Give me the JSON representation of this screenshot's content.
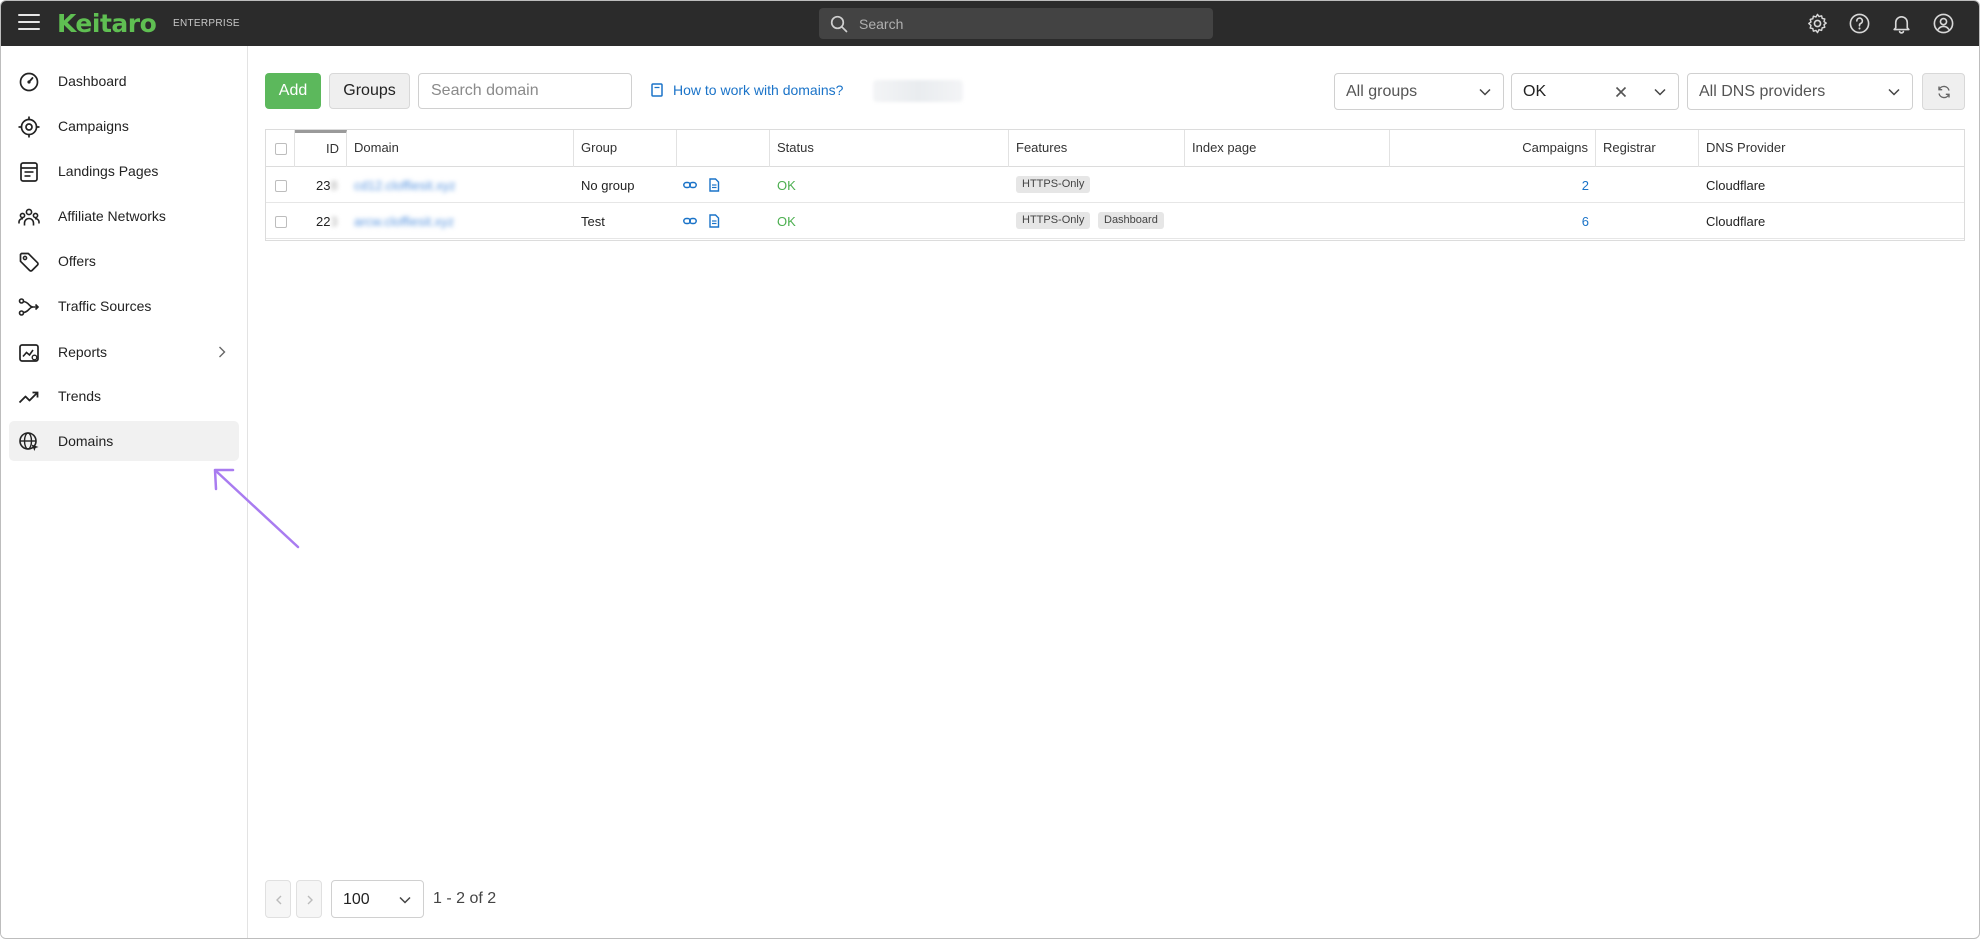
{
  "app": {
    "logo": "Keitaro",
    "edition": "ENTERPRISE",
    "search_placeholder": "Search"
  },
  "header_icons": [
    "gear-icon",
    "help-icon",
    "bell-icon",
    "user-icon"
  ],
  "sidebar": {
    "items": [
      {
        "label": "Dashboard",
        "icon": "dashboard-icon"
      },
      {
        "label": "Campaigns",
        "icon": "target-icon"
      },
      {
        "label": "Landings Pages",
        "icon": "landing-icon"
      },
      {
        "label": "Affiliate Networks",
        "icon": "network-icon"
      },
      {
        "label": "Offers",
        "icon": "tag-icon"
      },
      {
        "label": "Traffic Sources",
        "icon": "traffic-icon"
      },
      {
        "label": "Reports",
        "icon": "reports-icon"
      },
      {
        "label": "Trends",
        "icon": "trend-icon"
      },
      {
        "label": "Domains",
        "icon": "globe-icon"
      }
    ],
    "active": "Domains"
  },
  "toolbar": {
    "add_label": "Add",
    "groups_label": "Groups",
    "search_placeholder": "Search domain",
    "howto_label": "How to work with domains?",
    "group_filter": "All groups",
    "status_filter": "OK",
    "dns_filter": "All DNS providers"
  },
  "table": {
    "columns": [
      "ID",
      "Domain",
      "Group",
      "",
      "Status",
      "Features",
      "Index page",
      "Campaigns",
      "Registrar",
      "DNS Provider"
    ],
    "rows": [
      {
        "id": "23",
        "domain": "cd12.cloffiesit.xyz",
        "group": "No group",
        "status": "OK",
        "features": [
          "HTTPS-Only"
        ],
        "index_page": "",
        "campaigns": "2",
        "registrar": "",
        "dns_provider": "Cloudflare"
      },
      {
        "id": "22",
        "domain": "arcw.cloffiesit.xyz",
        "group": "Test",
        "status": "OK",
        "features": [
          "HTTPS-Only",
          "Dashboard"
        ],
        "index_page": "",
        "campaigns": "6",
        "registrar": "",
        "dns_provider": "Cloudflare"
      }
    ]
  },
  "pagination": {
    "per_page": "100",
    "info": "1 - 2 of 2"
  },
  "colors": {
    "brand": "#5fbf52",
    "add_button": "#5cb85c",
    "link": "#1a73c8",
    "status_ok": "#4caf50",
    "annotation_arrow": "#a97cf0"
  }
}
